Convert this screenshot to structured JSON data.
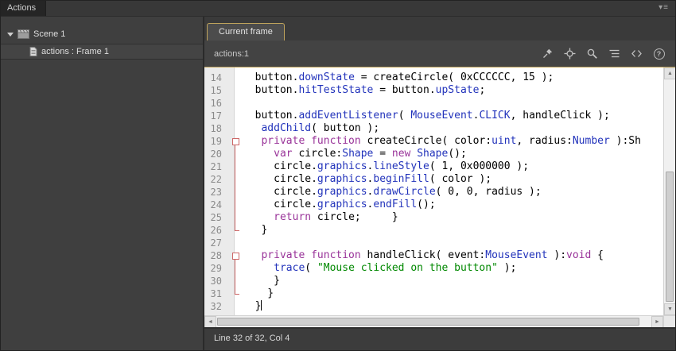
{
  "colors": {
    "accent_gold": "#bfa35c",
    "fold_marker": "#cc6666",
    "syntax": {
      "d": "#000000",
      "b": "#2233bb",
      "k": "#993399",
      "s": "#008800"
    }
  },
  "window": {
    "panel_tab": "Actions"
  },
  "icons": {
    "panel_menu": "▾≡",
    "scroll_up": "▲",
    "scroll_down": "▼",
    "scroll_left": "◄",
    "scroll_right": "►",
    "help_glyph": "?"
  },
  "sidebar": {
    "items": [
      {
        "label": "Scene 1",
        "icon": "scene-icon"
      },
      {
        "label": "actions : Frame 1",
        "icon": "frame-script-icon"
      }
    ]
  },
  "editor": {
    "tab_label": "Current frame",
    "script_label": "actions:1",
    "status": "Line 32 of 32, Col 4",
    "toolbar_icons": [
      "pin-icon",
      "target-icon",
      "find-icon",
      "format-icon",
      "code-icon",
      "help-icon"
    ],
    "lines": [
      {
        "n": 14,
        "fold": "",
        "tokens": [
          [
            "  button.",
            "d"
          ],
          [
            "downState",
            "b"
          ],
          [
            " = createCircle( 0xCCCCCC, 15 );",
            "d"
          ]
        ]
      },
      {
        "n": 15,
        "fold": "",
        "tokens": [
          [
            "  button.",
            "d"
          ],
          [
            "hitTestState",
            "b"
          ],
          [
            " = button.",
            "d"
          ],
          [
            "upState",
            "b"
          ],
          [
            ";",
            "d"
          ]
        ]
      },
      {
        "n": 16,
        "fold": "",
        "tokens": []
      },
      {
        "n": 17,
        "fold": "",
        "tokens": [
          [
            "  button.",
            "d"
          ],
          [
            "addEventListener",
            "b"
          ],
          [
            "( ",
            "d"
          ],
          [
            "MouseEvent",
            "b"
          ],
          [
            ".",
            "d"
          ],
          [
            "CLICK",
            "b"
          ],
          [
            ", handleClick );",
            "d"
          ]
        ]
      },
      {
        "n": 18,
        "fold": "",
        "tokens": [
          [
            "   ",
            "d"
          ],
          [
            "addChild",
            "b"
          ],
          [
            "( button );",
            "d"
          ]
        ]
      },
      {
        "n": 19,
        "fold": "box",
        "tokens": [
          [
            "   ",
            "d"
          ],
          [
            "private function",
            "k"
          ],
          [
            " createCircle( color:",
            "d"
          ],
          [
            "uint",
            "b"
          ],
          [
            ", radius:",
            "d"
          ],
          [
            "Number",
            "b"
          ],
          [
            " ):Sh",
            "d"
          ]
        ]
      },
      {
        "n": 20,
        "fold": "line",
        "tokens": [
          [
            "     ",
            "d"
          ],
          [
            "var",
            "k"
          ],
          [
            " circle:",
            "d"
          ],
          [
            "Shape",
            "b"
          ],
          [
            " = ",
            "d"
          ],
          [
            "new",
            "k"
          ],
          [
            " ",
            "d"
          ],
          [
            "Shape",
            "b"
          ],
          [
            "();",
            "d"
          ]
        ]
      },
      {
        "n": 21,
        "fold": "line",
        "tokens": [
          [
            "     circle.",
            "d"
          ],
          [
            "graphics",
            "b"
          ],
          [
            ".",
            "d"
          ],
          [
            "lineStyle",
            "b"
          ],
          [
            "( 1, 0x000000 );",
            "d"
          ]
        ]
      },
      {
        "n": 22,
        "fold": "line",
        "tokens": [
          [
            "     circle.",
            "d"
          ],
          [
            "graphics",
            "b"
          ],
          [
            ".",
            "d"
          ],
          [
            "beginFill",
            "b"
          ],
          [
            "( color );",
            "d"
          ]
        ]
      },
      {
        "n": 23,
        "fold": "line",
        "tokens": [
          [
            "     circle.",
            "d"
          ],
          [
            "graphics",
            "b"
          ],
          [
            ".",
            "d"
          ],
          [
            "drawCircle",
            "b"
          ],
          [
            "( 0, 0, radius );",
            "d"
          ]
        ]
      },
      {
        "n": 24,
        "fold": "line",
        "tokens": [
          [
            "     circle.",
            "d"
          ],
          [
            "graphics",
            "b"
          ],
          [
            ".",
            "d"
          ],
          [
            "endFill",
            "b"
          ],
          [
            "();",
            "d"
          ]
        ]
      },
      {
        "n": 25,
        "fold": "line",
        "tokens": [
          [
            "     ",
            "d"
          ],
          [
            "return",
            "k"
          ],
          [
            " circle;     }",
            "d"
          ]
        ]
      },
      {
        "n": 26,
        "fold": "end",
        "tokens": [
          [
            "   }",
            "d"
          ]
        ]
      },
      {
        "n": 27,
        "fold": "",
        "tokens": []
      },
      {
        "n": 28,
        "fold": "box",
        "tokens": [
          [
            "   ",
            "d"
          ],
          [
            "private function",
            "k"
          ],
          [
            " handleClick( event:",
            "d"
          ],
          [
            "MouseEvent",
            "b"
          ],
          [
            " ):",
            "d"
          ],
          [
            "void",
            "k"
          ],
          [
            " {",
            "d"
          ]
        ]
      },
      {
        "n": 29,
        "fold": "line",
        "tokens": [
          [
            "     ",
            "d"
          ],
          [
            "trace",
            "b"
          ],
          [
            "( ",
            "d"
          ],
          [
            "\"Mouse clicked on the button\"",
            "s"
          ],
          [
            " );",
            "d"
          ]
        ]
      },
      {
        "n": 30,
        "fold": "line",
        "tokens": [
          [
            "     }",
            "d"
          ]
        ]
      },
      {
        "n": 31,
        "fold": "end",
        "tokens": [
          [
            "    }",
            "d"
          ]
        ]
      },
      {
        "n": 32,
        "fold": "",
        "cursor": true,
        "tokens": [
          [
            "  }",
            "d"
          ]
        ]
      }
    ]
  }
}
